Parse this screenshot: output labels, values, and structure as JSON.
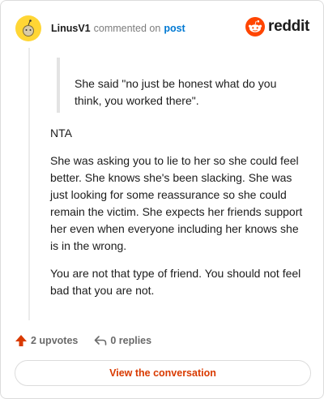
{
  "header": {
    "username": "LinusV1",
    "action": "commented on",
    "post_link": "post",
    "avatar_icon": "snoo-avatar",
    "avatar_color": "#ffd635"
  },
  "brand": {
    "name": "reddit",
    "logo_icon": "reddit-logo",
    "accent": "#ff4500"
  },
  "comment": {
    "quote": "She said \"no just be honest what do you think, you worked there\".",
    "paragraphs": [
      "NTA",
      "She was asking you to lie to her so she could feel better. She knows she's been slacking. She was just looking for some reassurance so she could remain the victim. She expects her friends support her even when everyone including her knows she is in the wrong.",
      "You are not that type of friend. You should not feel bad that you are not."
    ]
  },
  "footer": {
    "upvotes": "2 upvotes",
    "replies": "0 replies",
    "upvote_icon": "upvote-arrow-icon",
    "reply_icon": "reply-arrow-icon",
    "upvote_color": "#d93a00"
  },
  "cta": {
    "label": "View the conversation"
  }
}
